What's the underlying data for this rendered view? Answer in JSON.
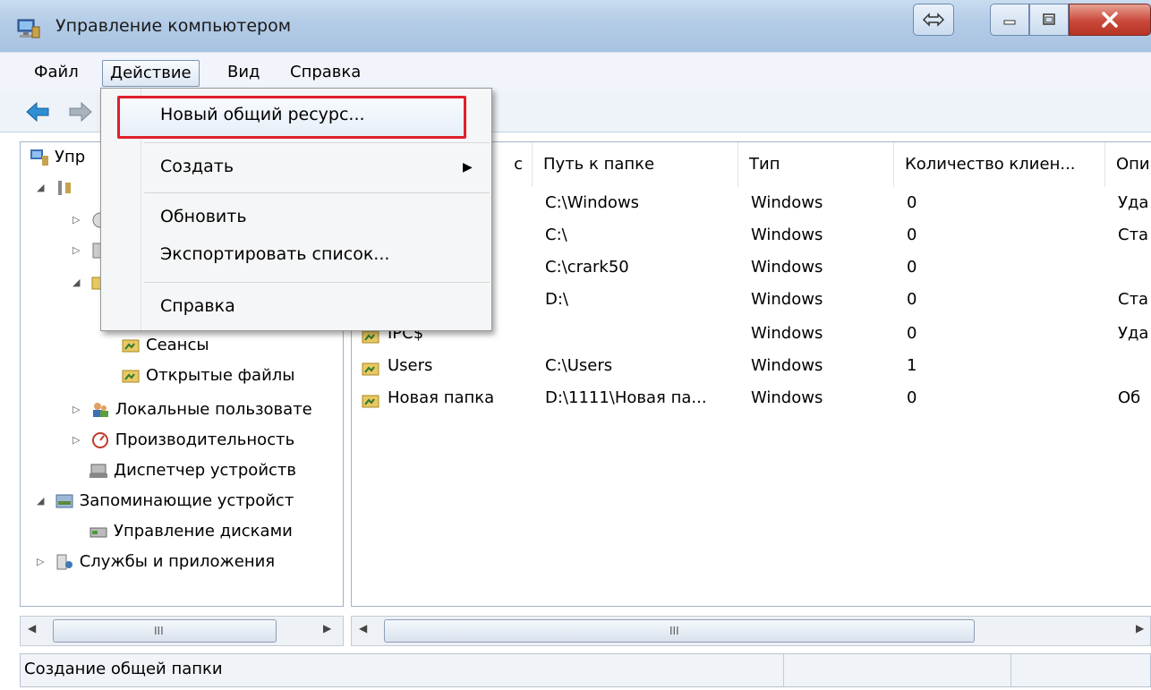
{
  "window": {
    "title": "Управление компьютером"
  },
  "menubar": {
    "file": "Файл",
    "action": "Действие",
    "view": "Вид",
    "help": "Справка"
  },
  "dropdown": {
    "items": [
      {
        "label": "Новый общий ресурс..."
      },
      {
        "label": "Создать"
      },
      {
        "label": "Обновить"
      },
      {
        "label": "Экспортировать список..."
      },
      {
        "label": "Справка"
      }
    ]
  },
  "tree": {
    "root_partial": "Упр",
    "sessions": "Сеансы",
    "open_files": "Открытые файлы",
    "local_users": "Локальные пользовате",
    "performance": "Производительность",
    "device_manager": "Диспетчер устройств",
    "storage": "Запоминающие устройст",
    "disk_management": "Управление дисками",
    "services_apps": "Службы и приложения"
  },
  "list": {
    "columns": [
      "с",
      "Путь к папке",
      "Тип",
      "Количество клиен...",
      "Опи"
    ],
    "rows": [
      {
        "name": "",
        "path": "C:\\Windows",
        "type": "Windows",
        "clients": "0",
        "desc": "Уда"
      },
      {
        "name": "",
        "path": "C:\\",
        "type": "Windows",
        "clients": "0",
        "desc": "Ста"
      },
      {
        "name": "",
        "path": "C:\\crark50",
        "type": "Windows",
        "clients": "0",
        "desc": ""
      },
      {
        "name": "",
        "path": "D:\\",
        "type": "Windows",
        "clients": "0",
        "desc": "Ста"
      },
      {
        "name": "IPC$",
        "path": "",
        "type": "Windows",
        "clients": "0",
        "desc": "Уда"
      },
      {
        "name": "Users",
        "path": "C:\\Users",
        "type": "Windows",
        "clients": "1",
        "desc": ""
      },
      {
        "name": "Новая папка",
        "path": "D:\\1111\\Новая па...",
        "type": "Windows",
        "clients": "0",
        "desc": "Об"
      }
    ]
  },
  "statusbar": {
    "text": "Создание общей папки"
  },
  "scroll": {
    "grip": "III"
  },
  "colors": {
    "highlight_border": "#e0202a",
    "title_gradient": "#b3cbe6",
    "close_button": "#c9483a"
  }
}
